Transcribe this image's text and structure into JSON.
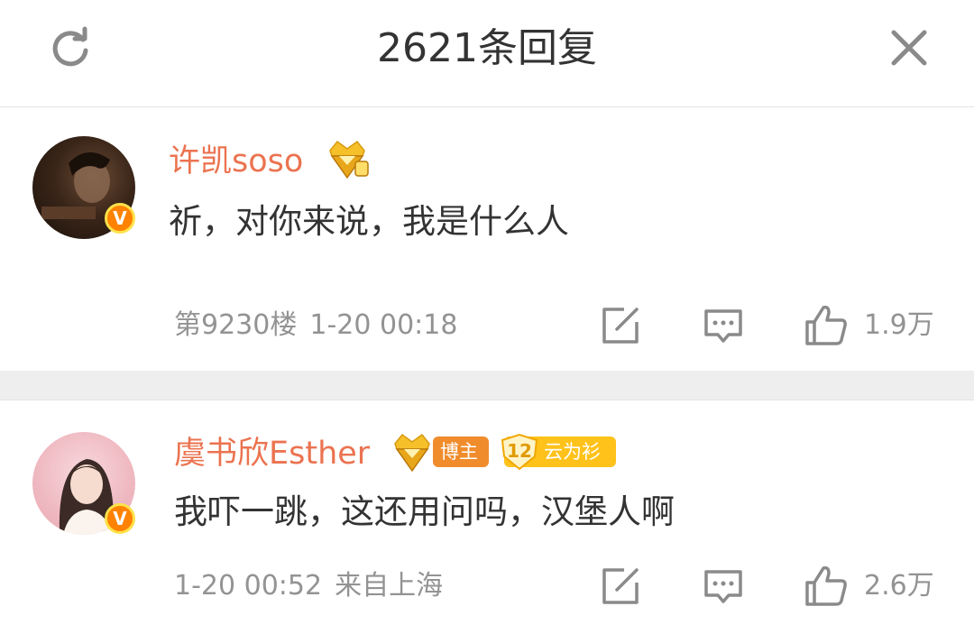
{
  "header": {
    "title": "2621条回复",
    "refresh_icon": "refresh-icon",
    "close_icon": "close-icon"
  },
  "comments": [
    {
      "username": "许凯soso",
      "text": "祈，对你来说，我是什么人",
      "floor": "第9230楼",
      "time": "1-20 00:18",
      "likes": "1.9万",
      "badge_icon": "crown-diamond-icon"
    },
    {
      "username": "虞书欣Esther",
      "text": "我吓一跳，这还用问吗，汉堡人啊",
      "time": "1-20 00:52",
      "location": "来自上海",
      "likes": "2.6万",
      "badge_icon": "crown-diamond-icon",
      "tag_blogger": "博主",
      "tag_fan_level": "12",
      "tag_fan_name": "云为衫"
    }
  ],
  "colors": {
    "username": "#eb7350",
    "verified": "#ff8200",
    "meta": "#939393",
    "separator": "#eeeeee"
  }
}
